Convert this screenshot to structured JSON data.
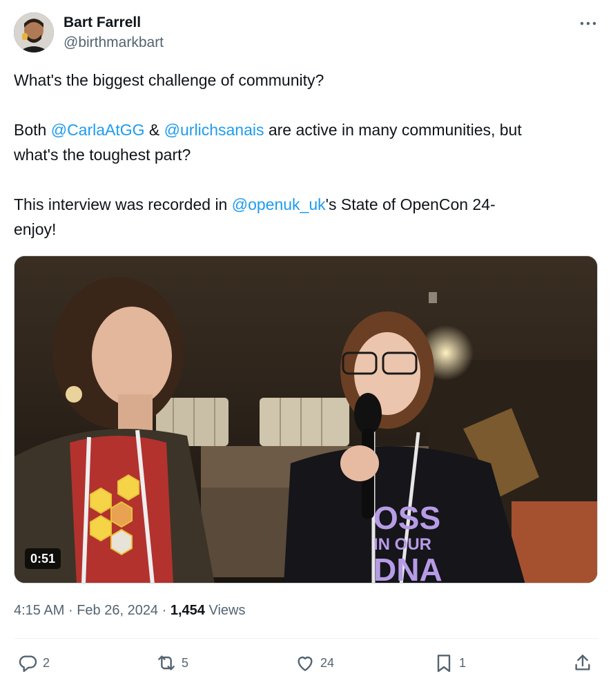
{
  "author": {
    "name": "Bart Farrell",
    "handle": "@birthmarkbart"
  },
  "tweet": {
    "line1": "What's the biggest challenge of community?",
    "p2_a": "Both ",
    "p2_mention1": "@CarlaAtGG",
    "p2_b": " & ",
    "p2_mention2": "@urlichsanais",
    "p2_c": " are active in many communities, but",
    "p2_line2": "what's the toughest part?",
    "p3_a": "This interview was recorded in ",
    "p3_mention": "@openuk_uk",
    "p3_b": "'s State of OpenCon 24-",
    "p3_line2": "enjoy!"
  },
  "video": {
    "duration": "0:51",
    "shirt_text_top": "OSS",
    "shirt_text_mid": "IN OUR",
    "shirt_text_bottom": "DNA"
  },
  "meta": {
    "time": "4:15 AM",
    "separator": "·",
    "date": "Feb 26, 2024",
    "views_count": "1,454",
    "views_label": "Views"
  },
  "actions": {
    "replies": "2",
    "reposts": "5",
    "likes": "24",
    "bookmarks": "1"
  },
  "colors": {
    "link": "#1d9bf0",
    "secondary_text": "#536471",
    "primary_text": "#0f1419"
  },
  "icons": [
    "more-icon",
    "reply-icon",
    "repost-icon",
    "like-icon",
    "bookmark-icon",
    "share-icon"
  ]
}
